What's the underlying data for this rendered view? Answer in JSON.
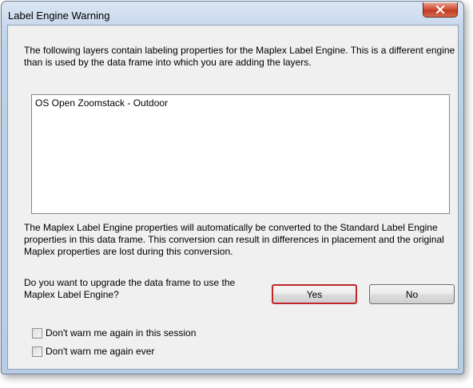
{
  "window": {
    "title": "Label Engine Warning"
  },
  "message": {
    "intro": "The following layers contain labeling properties for the Maplex Label Engine. This is a different engine than is used by the data frame into which you are adding the layers.",
    "conversion": "The Maplex Label Engine properties will automatically be converted to the Standard Label Engine properties in this data frame. This conversion can result in differences in placement and the original Maplex properties are lost during this conversion.",
    "question": "Do you want to upgrade the data frame to use the Maplex Label Engine?"
  },
  "layers": {
    "items": [
      "OS Open Zoomstack - Outdoor"
    ]
  },
  "buttons": {
    "yes_label": "Yes",
    "no_label": "No"
  },
  "options": {
    "session_label": "Don't warn me again in this session",
    "ever_label": "Don't warn me again ever",
    "session_checked": false,
    "ever_checked": false
  },
  "icons": {
    "close": "close-icon"
  },
  "colors": {
    "default_button_border": "#c0272d",
    "close_button": "#c33a22"
  }
}
